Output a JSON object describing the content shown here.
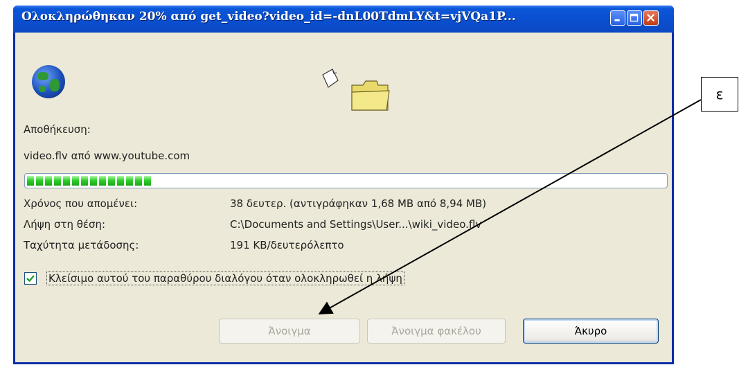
{
  "window": {
    "title": "Ολοκληρώθηκαν 20% από get_video?video_id=-dnL00TdmLY&t=vjVQa1P...",
    "buttons": [
      "minimize-icon",
      "maximize-icon",
      "close-icon"
    ]
  },
  "saving": {
    "label": "Αποθήκευση:",
    "file": "video.flv από www.youtube.com"
  },
  "progress": {
    "percent": 20,
    "color": "#2fd12a"
  },
  "details": [
    {
      "label": "Χρόνος που απομένει:",
      "value": "38 δευτερ. (αντιγράφηκαν 1,68 MB από 8,94 MB)"
    },
    {
      "label": "Λήψη στη θέση:",
      "value": "C:\\Documents and Settings\\User...\\wiki_video.flv"
    },
    {
      "label": "Ταχύτητα μετάδοσης:",
      "value": "191 KB/δευτερόλεπτο"
    }
  ],
  "close_when_done": {
    "checked": true,
    "label": "Κλείσιμο αυτού του παραθύρου διαλόγου όταν ολοκληρωθεί η λήψη"
  },
  "buttons": {
    "open": "Άνοιγμα",
    "open_folder": "Άνοιγμα φακέλου",
    "cancel": "Άκυρο"
  },
  "annotation": {
    "label": "ε"
  },
  "colors": {
    "titlebar": "#0a4fd0",
    "dialog_bg": "#ece9d8"
  }
}
